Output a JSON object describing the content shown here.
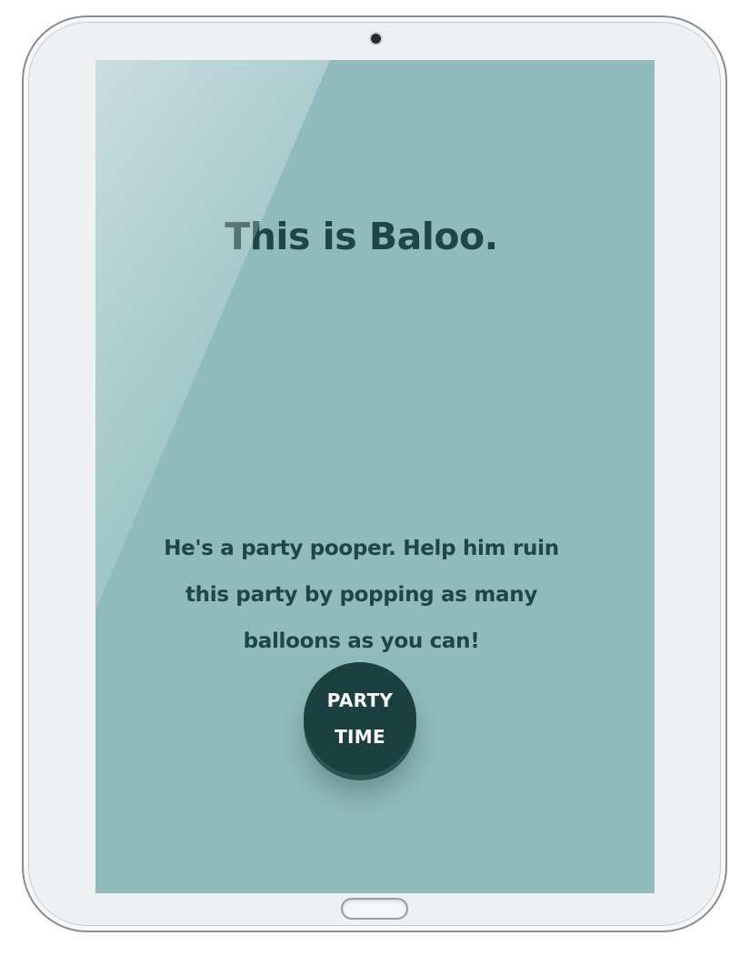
{
  "screen": {
    "title": "This is Baloo.",
    "intro": "He's a party pooper. Help him ruin this party by popping as many balloons as you can!",
    "button_label": "PARTY TIME"
  },
  "colors": {
    "background": "#8fbbbc",
    "text": "#1f4644",
    "button": "#1b403e",
    "button_text": "#ffffff",
    "device_frame": "#eef0f2"
  }
}
